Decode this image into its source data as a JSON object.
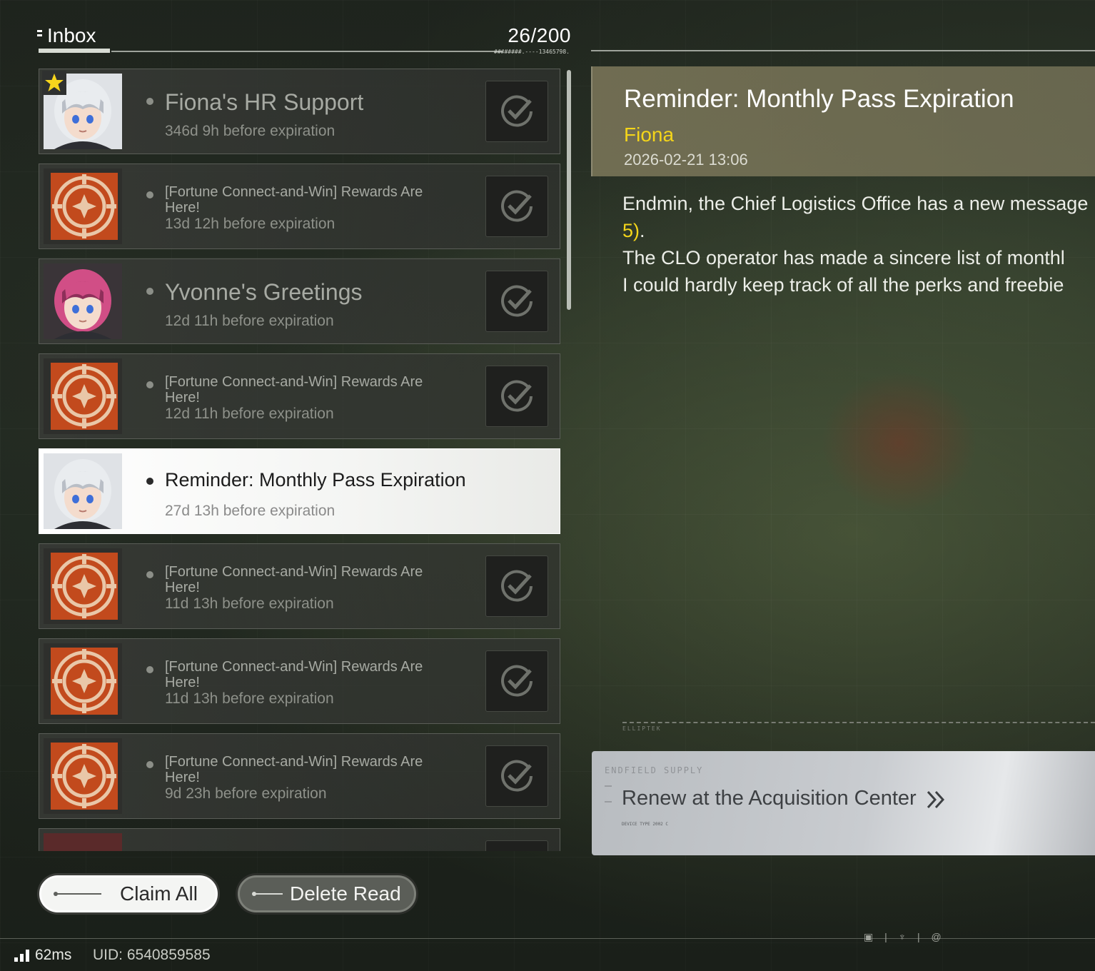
{
  "header": {
    "title": "Inbox",
    "count": "26/200",
    "count_sub": "########.----13465798."
  },
  "mail_list": [
    {
      "type": "portrait",
      "avatar": "white-hair-girl",
      "starred": true,
      "title": "Fiona's HR Support",
      "expiry": "346d 9h before expiration",
      "claimed": true
    },
    {
      "type": "fortune",
      "avatar": "fortune-emblem",
      "starred": false,
      "title": "[Fortune Connect-and-Win] Rewards Are Here!",
      "expiry": "13d 12h before expiration",
      "claimed": true
    },
    {
      "type": "portrait",
      "avatar": "pink-hair-girl",
      "starred": false,
      "title": "Yvonne's Greetings",
      "expiry": "12d 11h before expiration",
      "claimed": true
    },
    {
      "type": "fortune",
      "avatar": "fortune-emblem",
      "starred": false,
      "title": "[Fortune Connect-and-Win] Rewards Are Here!",
      "expiry": "12d 11h before expiration",
      "claimed": true
    },
    {
      "type": "portrait",
      "avatar": "white-hair-girl",
      "starred": false,
      "selected": true,
      "title": "Reminder: Monthly Pass Expiration",
      "expiry": "27d 13h before expiration",
      "claimed": false
    },
    {
      "type": "fortune",
      "avatar": "fortune-emblem",
      "starred": false,
      "title": "[Fortune Connect-and-Win] Rewards Are Here!",
      "expiry": "11d 13h before expiration",
      "claimed": true
    },
    {
      "type": "fortune",
      "avatar": "fortune-emblem",
      "starred": false,
      "title": "[Fortune Connect-and-Win] Rewards Are Here!",
      "expiry": "11d 13h before expiration",
      "claimed": true
    },
    {
      "type": "fortune",
      "avatar": "fortune-emblem",
      "starred": false,
      "title": "[Fortune Connect-and-Win] Rewards Are Here!",
      "expiry": "9d 23h before expiration",
      "claimed": true
    }
  ],
  "detail": {
    "title": "Reminder: Monthly Pass Expiration",
    "sender": "Fiona",
    "date": "2026-02-21 13:06",
    "body_line1": "Endmin, the Chief Logistics Office has a new message",
    "body_line2_highlight": "5)",
    "body_line2_rest": ".",
    "body_line3": "The CLO operator has made a sincere list of monthl",
    "body_line4": "I could hardly keep track of all the perks and freebie",
    "divider_label": "ELLIPTEK"
  },
  "supply": {
    "brand": "ENDFIELD SUPPLY",
    "label": "Renew at the Acquisition Center",
    "meta": "DEVICE TYPE 2002 C"
  },
  "buttons": {
    "claim_all": "Claim All",
    "delete_read": "Delete Read"
  },
  "footer": {
    "ping": "62ms",
    "uid": "UID: 6540859585",
    "icons": "▣ | ♆ | @"
  },
  "colors": {
    "accent_yellow": "#f4d51a",
    "fortune_orange": "#c24a1d",
    "selected_bg": "#ffffff"
  }
}
